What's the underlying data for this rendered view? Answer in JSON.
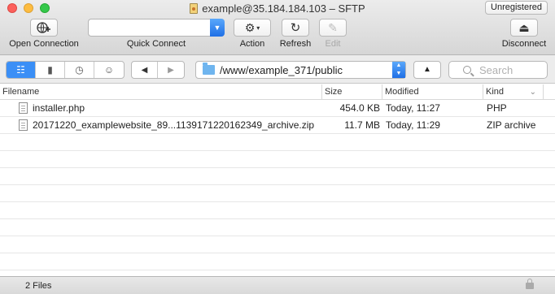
{
  "window": {
    "title": "example@35.184.184.103 – SFTP",
    "unregistered_label": "Unregistered"
  },
  "toolbar": {
    "open_connection_label": "Open Connection",
    "quick_connect_label": "Quick Connect",
    "quick_connect_value": "",
    "action_label": "Action",
    "refresh_label": "Refresh",
    "edit_label": "Edit",
    "disconnect_label": "Disconnect"
  },
  "navbar": {
    "view_modes": [
      "browser-view",
      "bookmarks-view",
      "history-view",
      "bonjour-view"
    ],
    "active_view": "browser-view",
    "path": "/www/example_371/public",
    "search_placeholder": "Search"
  },
  "table": {
    "columns": [
      "Filename",
      "Size",
      "Modified",
      "Kind"
    ],
    "rows": [
      {
        "filename": "installer.php",
        "size": "454.0 KB",
        "modified": "Today, 11:27",
        "kind": "PHP"
      },
      {
        "filename": "20171220_examplewebsite_89...1139171220162349_archive.zip",
        "size": "11.7 MB",
        "modified": "Today, 11:29",
        "kind": "ZIP archive"
      }
    ]
  },
  "status": {
    "text": "2 Files"
  },
  "colors": {
    "accent": "#3b8ff6",
    "toolbar_top": "#ececec",
    "toolbar_bottom": "#d6d6d6"
  }
}
